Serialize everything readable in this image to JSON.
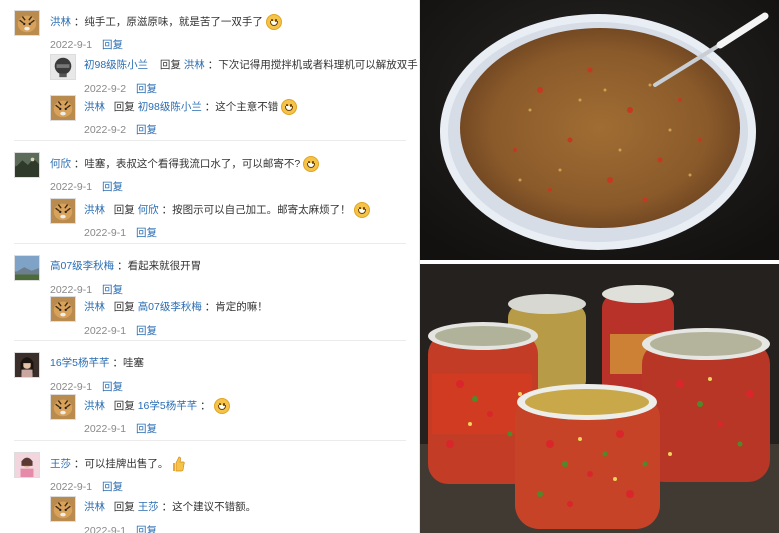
{
  "comments": [
    {
      "user": "洪林",
      "text": "：纯手工，原滋原味，就是苦了一双手了",
      "emoji": "grin-emoji",
      "date": "2022-9-1",
      "reply_label": "回复",
      "replies": [
        {
          "user": "初98级陈小兰",
          "reply_word": "回复",
          "target": "洪林",
          "text": "：下次记得用搅拌机或者料理机可以解放双手",
          "date": "2022-9-2",
          "reply_label": "回复"
        },
        {
          "user": "洪林",
          "reply_word": "回复",
          "target": "初98级陈小兰",
          "text": "：这个主意不错",
          "emoji": "smile-emoji",
          "date": "2022-9-2",
          "reply_label": "回复"
        }
      ]
    },
    {
      "user": "何欣",
      "text": "：哇塞，表叔这个看得我流口水了，可以邮寄不?",
      "emoji": "grin-emoji",
      "date": "2022-9-1",
      "reply_label": "回复",
      "replies": [
        {
          "user": "洪林",
          "reply_word": "回复",
          "target": "何欣",
          "text": "：按图示可以自己加工。邮寄太麻烦了！",
          "emoji": "shy-emoji",
          "date": "2022-9-1",
          "reply_label": "回复"
        }
      ]
    },
    {
      "user": "高07级李秋梅",
      "text": "：看起来就很开胃",
      "date": "2022-9-1",
      "reply_label": "回复",
      "replies": [
        {
          "user": "洪林",
          "reply_word": "回复",
          "target": "高07级李秋梅",
          "text": "：肯定的嘛！",
          "date": "2022-9-1",
          "reply_label": "回复"
        }
      ]
    },
    {
      "user": "16学5杨芊芊",
      "text": "：哇塞",
      "date": "2022-9-1",
      "reply_label": "回复",
      "replies": [
        {
          "user": "洪林",
          "reply_word": "回复",
          "target": "16学5杨芊芊",
          "text": "：",
          "emoji": "smile-emoji",
          "date": "2022-9-1",
          "reply_label": "回复"
        }
      ]
    },
    {
      "user": "王莎",
      "text": "：可以挂牌出售了。",
      "emoji": "thumbs-up-emoji",
      "date": "2022-9-1",
      "reply_label": "回复",
      "replies": [
        {
          "user": "洪林",
          "reply_word": "回复",
          "target": "王莎",
          "text": "：这个建议不错额。",
          "date": "2022-9-1",
          "reply_label": "回复"
        }
      ]
    }
  ],
  "colors": {
    "link": "#2a6db3",
    "date": "#888888",
    "emoji": "#f5c24a"
  }
}
